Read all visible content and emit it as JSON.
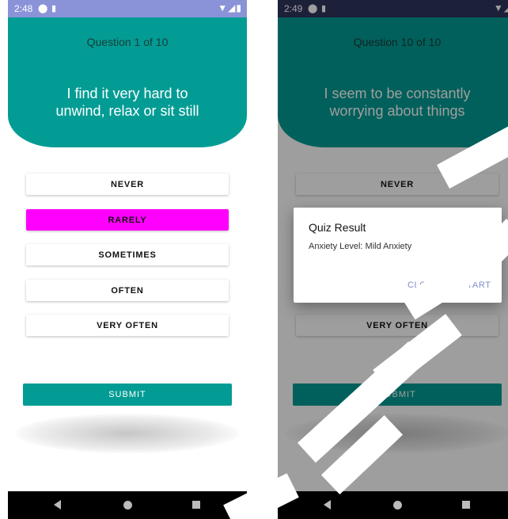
{
  "left_screen": {
    "status": {
      "time": "2:48",
      "left_icons": [
        "app-icon",
        "sim-icon"
      ],
      "right_icons": [
        "wifi-icon",
        "signal-icon",
        "battery-icon"
      ]
    },
    "header": {
      "counter": "Question 1 of 10",
      "question_line1": "I find it very hard to",
      "question_line2": "unwind, relax or sit still"
    },
    "options": [
      "NEVER",
      "RARELY",
      "SOMETIMES",
      "OFTEN",
      "VERY OFTEN"
    ],
    "selected_option": "RARELY",
    "submit_label": "SUBMIT",
    "colors": {
      "header": "#039c94",
      "selected": "#ff00ff",
      "status_bar": "#8a93d8"
    }
  },
  "right_screen": {
    "status": {
      "time": "2:49",
      "left_icons": [
        "app-icon",
        "sim-icon"
      ],
      "right_icons": [
        "wifi-icon",
        "signal-icon"
      ]
    },
    "header": {
      "counter": "Question 10 of 10",
      "question_line1": "I seem to be constantly",
      "question_line2": "worrying about things"
    },
    "visible_options": [
      "NEVER",
      "VERY OFTEN"
    ],
    "submit_label": "SUBMIT",
    "dialog": {
      "title": "Quiz Result",
      "message": "Anxiety Level: Mild Anxiety",
      "buttons": [
        "CLOSE",
        "RESTART"
      ]
    },
    "colors": {
      "dialog_button": "#7f8ccb",
      "status_bar": "#2f355c"
    }
  },
  "nav_bar_icons": [
    "back-icon",
    "home-icon",
    "recents-icon"
  ]
}
